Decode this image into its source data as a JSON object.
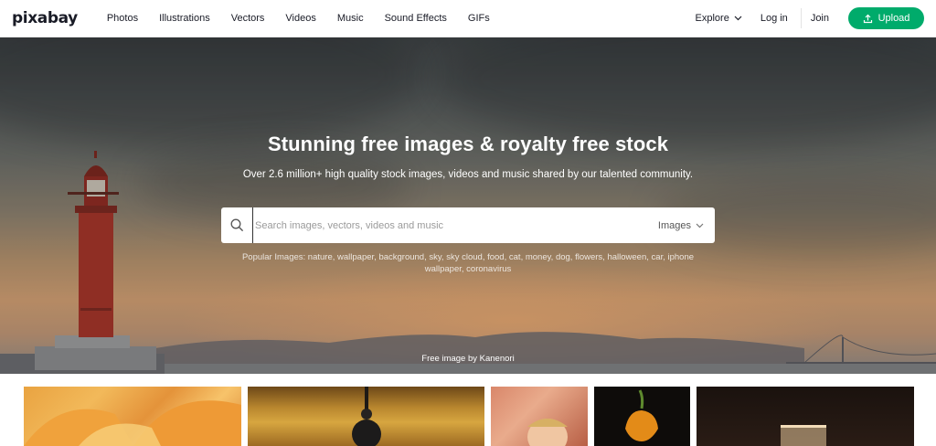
{
  "header": {
    "logo": "pixabay",
    "nav": [
      "Photos",
      "Illustrations",
      "Vectors",
      "Videos",
      "Music",
      "Sound Effects",
      "GIFs"
    ],
    "explore_label": "Explore",
    "login_label": "Log in",
    "join_label": "Join",
    "upload_label": "Upload"
  },
  "hero": {
    "title": "Stunning free images & royalty free stock",
    "subtitle": "Over 2.6 million+ high quality stock images, videos and music shared by our talented community.",
    "search": {
      "placeholder": "Search images, vectors, videos and music",
      "value": "",
      "type_label": "Images"
    },
    "popular_prefix": "Popular Images:",
    "popular_tags": [
      "nature",
      "wallpaper",
      "background",
      "sky",
      "sky cloud",
      "food",
      "cat",
      "money",
      "dog",
      "flowers",
      "halloween",
      "car",
      "iphone wallpaper",
      "coronavirus"
    ],
    "credit": "Free image by Kanenori"
  },
  "colors": {
    "brand_green": "#00ab6b",
    "text_dark": "#191b26"
  },
  "icons": {
    "search": "search-icon",
    "chevron": "chevron-down-icon",
    "upload": "upload-icon"
  },
  "thumbnails": [
    "cantaloupe-melon",
    "hanging-lamp",
    "child-portrait",
    "hot-pepper",
    "dark-cocktail-glass"
  ]
}
